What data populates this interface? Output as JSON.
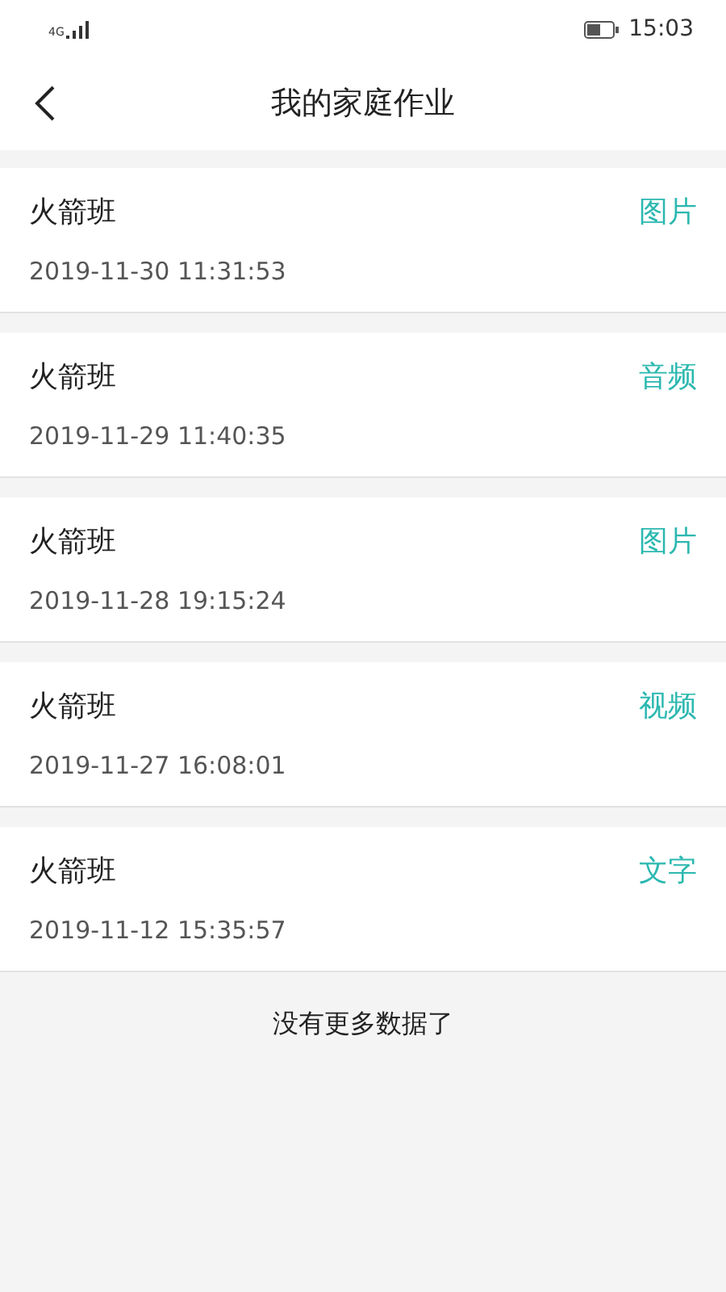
{
  "status_bar": {
    "network": "4G",
    "time": "15:03"
  },
  "header": {
    "title": "我的家庭作业"
  },
  "items": [
    {
      "class_name": "火箭班",
      "type": "图片",
      "time": "2019-11-30 11:31:53"
    },
    {
      "class_name": "火箭班",
      "type": "音频",
      "time": "2019-11-29 11:40:35"
    },
    {
      "class_name": "火箭班",
      "type": "图片",
      "time": "2019-11-28 19:15:24"
    },
    {
      "class_name": "火箭班",
      "type": "视频",
      "time": "2019-11-27 16:08:01"
    },
    {
      "class_name": "火箭班",
      "type": "文字",
      "time": "2019-11-12 15:35:57"
    }
  ],
  "footer": "没有更多数据了"
}
